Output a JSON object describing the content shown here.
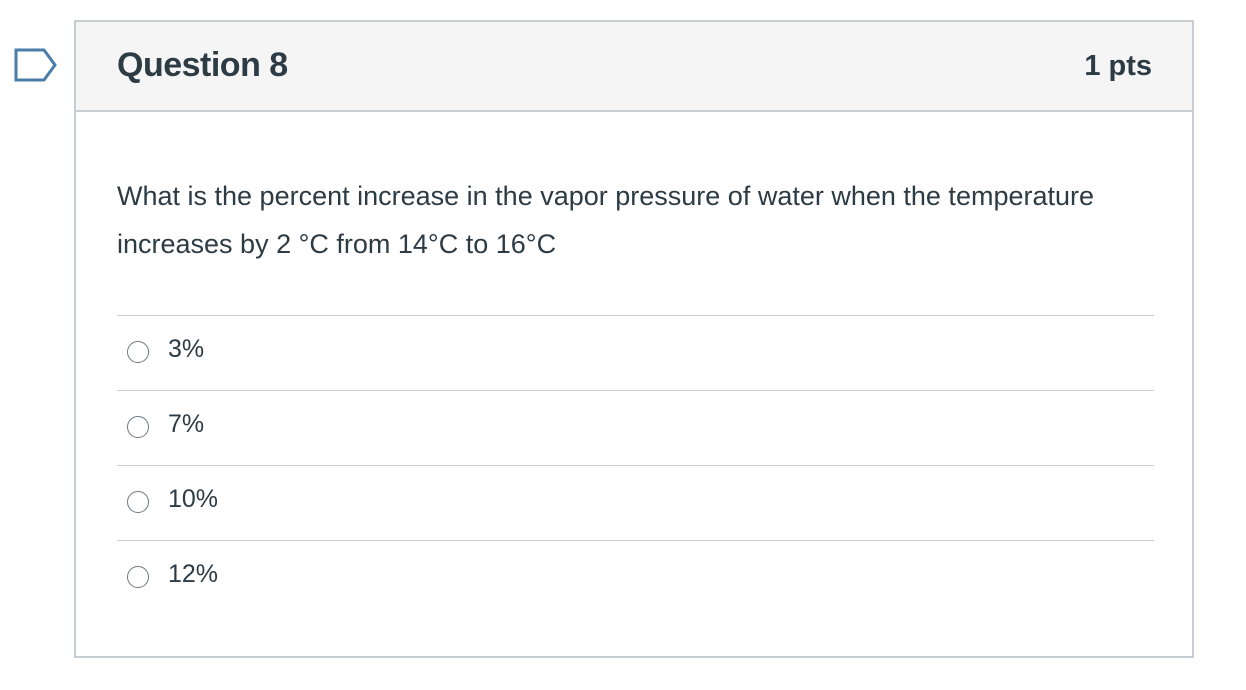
{
  "icons": {
    "flag": "flag-outline-icon",
    "radio": "radio-unselected-icon"
  },
  "colors": {
    "text": "#2d3b45",
    "border": "#c7cdd1",
    "header_bg": "#f5f5f5",
    "flag": "#4a7da8"
  },
  "question": {
    "title": "Question 8",
    "points": "1 pts",
    "text": "What is the percent increase in the vapor pressure of water when the temperature increases by 2 °C from 14°C  to 16°C",
    "answers": [
      {
        "label": "3%"
      },
      {
        "label": "7%"
      },
      {
        "label": "10%"
      },
      {
        "label": "12%"
      }
    ]
  }
}
